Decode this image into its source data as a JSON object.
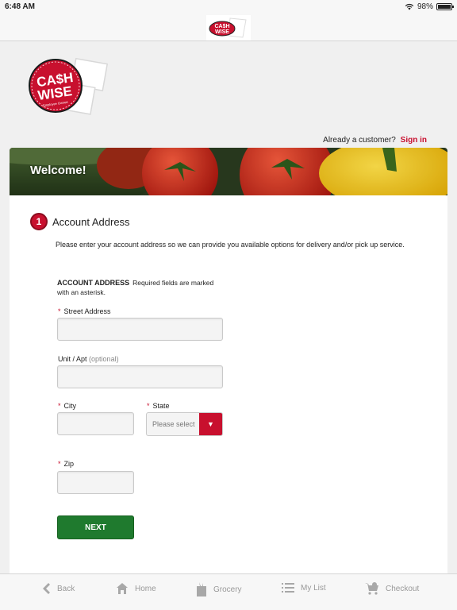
{
  "status_bar": {
    "time": "6:48 AM",
    "battery": "98%",
    "battery_level": 0.98
  },
  "brand": {
    "name": "CASH WISE",
    "tagline": "Employee Owned"
  },
  "header": {
    "customer_prompt": "Already a customer?",
    "sign_in": "Sign in"
  },
  "banner": {
    "title": "Welcome!"
  },
  "step": {
    "number": "1",
    "title": "Account Address"
  },
  "intro": "Please enter your account address so we can provide you available options for delivery and/or pick up service.",
  "section": {
    "title": "ACCOUNT ADDRESS",
    "note": "Required fields are marked with an asterisk."
  },
  "form": {
    "street": {
      "required_mark": "*",
      "label": "Street Address",
      "value": ""
    },
    "unit": {
      "label": "Unit / Apt",
      "optional": "(optional)",
      "value": ""
    },
    "city": {
      "required_mark": "*",
      "label": "City",
      "value": ""
    },
    "state": {
      "required_mark": "*",
      "label": "State",
      "placeholder": "Please select",
      "arrow": "▼"
    },
    "zip": {
      "required_mark": "*",
      "label": "Zip",
      "value": ""
    },
    "next_label": "NEXT"
  },
  "tab_bar": {
    "back": "Back",
    "home": "Home",
    "grocery": "Grocery",
    "my_list": "My List",
    "checkout": "Checkout"
  },
  "colors": {
    "brand_red": "#c8102e",
    "next_green": "#1f7a2e"
  }
}
